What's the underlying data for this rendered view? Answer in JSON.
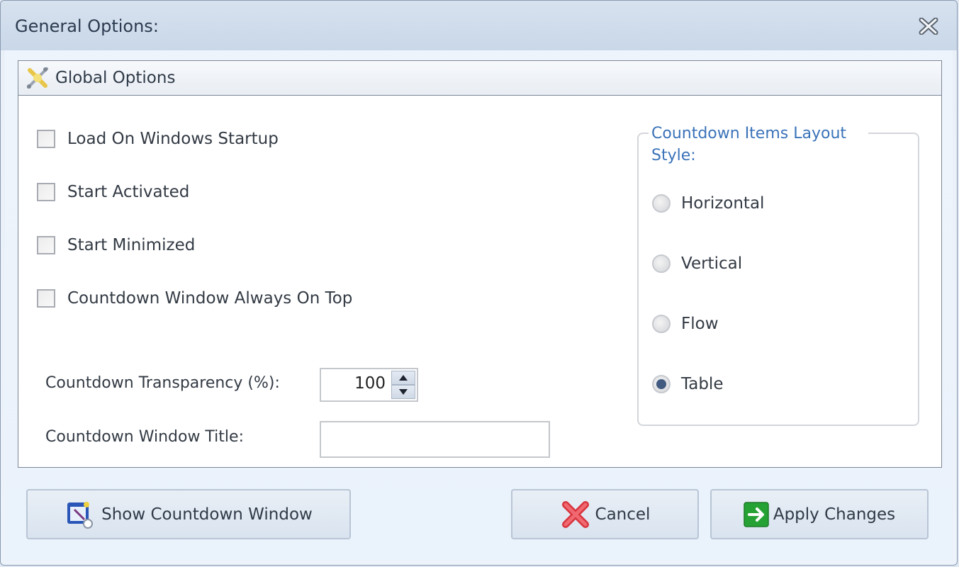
{
  "window": {
    "title": "General Options:",
    "close_icon": "close-icon"
  },
  "panel": {
    "title": "Global Options",
    "icon": "tools-icon"
  },
  "checkboxes": [
    {
      "label": "Load On Windows Startup",
      "checked": false
    },
    {
      "label": "Start Activated",
      "checked": false
    },
    {
      "label": "Start Minimized",
      "checked": false
    },
    {
      "label": "Countdown Window Always On Top",
      "checked": false
    }
  ],
  "transparency": {
    "label": "Countdown Transparency (%):",
    "value": "100"
  },
  "window_title_field": {
    "label": "Countdown Window Title:",
    "value": ""
  },
  "layout_style": {
    "title": "Countdown Items Layout Style:",
    "options": [
      {
        "label": "Horizontal",
        "selected": false
      },
      {
        "label": "Vertical",
        "selected": false
      },
      {
        "label": "Flow",
        "selected": false
      },
      {
        "label": "Table",
        "selected": true
      }
    ]
  },
  "buttons": {
    "show_countdown": "Show Countdown Window",
    "cancel": "Cancel",
    "apply": "Apply Changes"
  },
  "colors": {
    "accent_text": "#3b73b9",
    "cancel_icon": "#e0404a",
    "apply_icon": "#2ea43a"
  }
}
